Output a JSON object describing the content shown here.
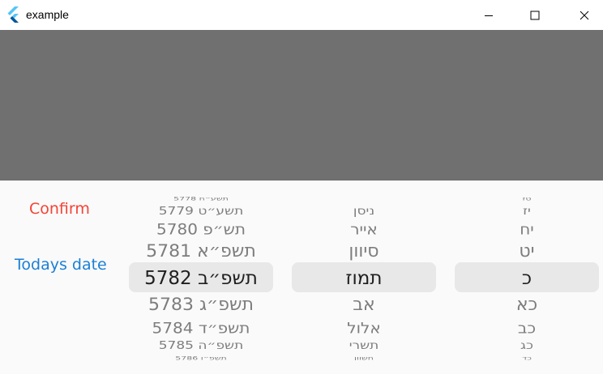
{
  "window": {
    "title": "example",
    "app_icon": "flutter-icon",
    "controls": [
      "minimize-icon",
      "maximize-icon",
      "close-icon"
    ]
  },
  "sheet": {
    "confirm_label": "Confirm",
    "today_label": "Todays date",
    "colors": {
      "confirm": "#f44336",
      "today": "#1a7fd6",
      "overlay": "#707070",
      "selection": "#e8e8e8"
    }
  },
  "picker": {
    "years": [
      "5778 תשע״ח",
      "5779 תשע״ט",
      "5780 תש״פ",
      "5781 תשפ״א",
      "5782 תשפ״ב",
      "5783 תשפ״ג",
      "5784 תשפ״ד",
      "5785 תשפ״ה",
      "5786 תשפ״ו"
    ],
    "months": [
      "ניסן",
      "אייר",
      "סיוון",
      "תמוז",
      "אב",
      "אלול",
      "תשרי",
      "חשוון"
    ],
    "days": [
      "טז",
      "יז",
      "יח",
      "יט",
      "כ",
      "כא",
      "כב",
      "כג",
      "כד"
    ],
    "selected": {
      "year": "5782 תשפ״ב",
      "month": "תמוז",
      "day": "כ"
    }
  }
}
